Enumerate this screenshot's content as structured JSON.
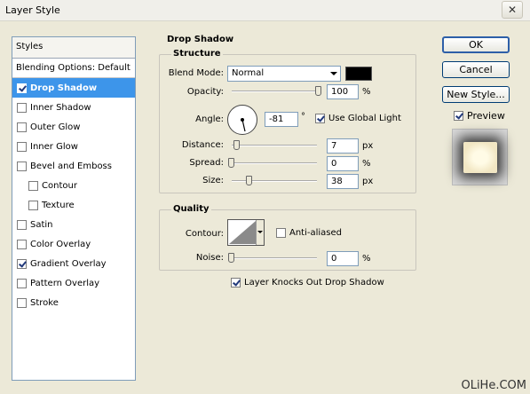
{
  "window": {
    "title": "Layer Style",
    "close_glyph": "✕"
  },
  "styles_panel": {
    "header": "Styles",
    "blending_options": "Blending Options: Default",
    "items": [
      {
        "label": "Drop Shadow",
        "checked": true,
        "selected": true
      },
      {
        "label": "Inner Shadow",
        "checked": false
      },
      {
        "label": "Outer Glow",
        "checked": false
      },
      {
        "label": "Inner Glow",
        "checked": false
      },
      {
        "label": "Bevel and Emboss",
        "checked": false
      },
      {
        "label": "Contour",
        "checked": false,
        "sub": true
      },
      {
        "label": "Texture",
        "checked": false,
        "sub": true
      },
      {
        "label": "Satin",
        "checked": false
      },
      {
        "label": "Color Overlay",
        "checked": false
      },
      {
        "label": "Gradient Overlay",
        "checked": true
      },
      {
        "label": "Pattern Overlay",
        "checked": false
      },
      {
        "label": "Stroke",
        "checked": false
      }
    ]
  },
  "drop_shadow": {
    "title": "Drop Shadow",
    "structure": {
      "title": "Structure",
      "blend_mode_label": "Blend Mode:",
      "blend_mode_value": "Normal",
      "shadow_color": "#000000",
      "opacity_label": "Opacity:",
      "opacity_value": "100",
      "opacity_unit": "%",
      "angle_label": "Angle:",
      "angle_value": "-81",
      "angle_unit": "°",
      "use_global_light_label": "Use Global Light",
      "use_global_light": true,
      "distance_label": "Distance:",
      "distance_value": "7",
      "distance_unit": "px",
      "spread_label": "Spread:",
      "spread_value": "0",
      "spread_unit": "%",
      "size_label": "Size:",
      "size_value": "38",
      "size_unit": "px"
    },
    "quality": {
      "title": "Quality",
      "contour_label": "Contour:",
      "anti_aliased_label": "Anti-aliased",
      "anti_aliased": false,
      "noise_label": "Noise:",
      "noise_value": "0",
      "noise_unit": "%"
    },
    "knocks_out_label": "Layer Knocks Out Drop Shadow",
    "knocks_out": true
  },
  "buttons": {
    "ok": "OK",
    "cancel": "Cancel",
    "new_style": "New Style...",
    "preview_label": "Preview",
    "preview_checked": true
  },
  "watermark": "OLiHe.COM"
}
